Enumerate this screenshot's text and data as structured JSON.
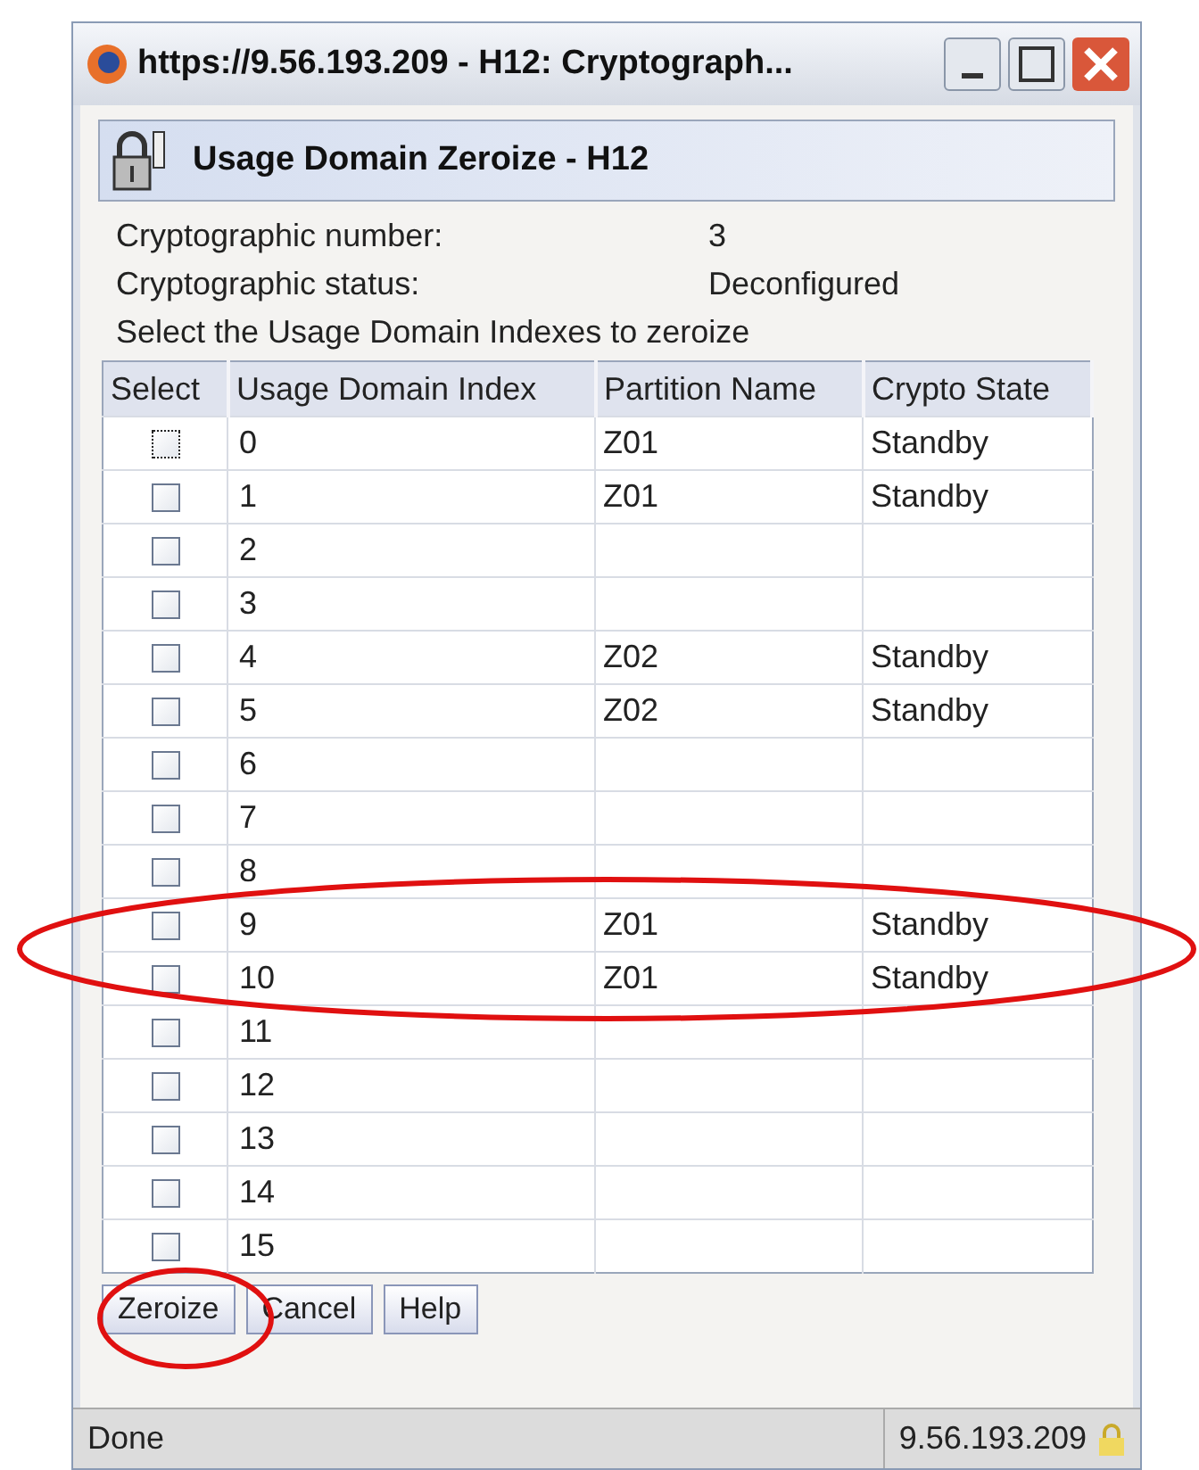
{
  "window": {
    "title": "https://9.56.193.209 - H12: Cryptograph..."
  },
  "header": {
    "title": "Usage Domain Zeroize - H12"
  },
  "info": [
    {
      "label": "Cryptographic number:",
      "value": "3"
    },
    {
      "label": "Cryptographic status:",
      "value": "Deconfigured"
    }
  ],
  "instruction": "Select the Usage Domain Indexes to zeroize",
  "table": {
    "columns": [
      "Select",
      "Usage Domain Index",
      "Partition Name",
      "Crypto State"
    ],
    "rows": [
      {
        "checked": false,
        "focused": true,
        "index": "0",
        "partition": "Z01",
        "state": "Standby"
      },
      {
        "checked": false,
        "focused": false,
        "index": "1",
        "partition": "Z01",
        "state": "Standby"
      },
      {
        "checked": false,
        "focused": false,
        "index": "2"
      },
      {
        "checked": false,
        "focused": false,
        "index": "3"
      },
      {
        "checked": false,
        "focused": false,
        "index": "4",
        "partition": "Z02",
        "state": "Standby"
      },
      {
        "checked": false,
        "focused": false,
        "index": "5",
        "partition": "Z02",
        "state": "Standby"
      },
      {
        "checked": false,
        "focused": false,
        "index": "6"
      },
      {
        "checked": false,
        "focused": false,
        "index": "7"
      },
      {
        "checked": false,
        "focused": false,
        "index": "8"
      },
      {
        "checked": false,
        "focused": false,
        "index": "9",
        "partition": "Z01",
        "state": "Standby"
      },
      {
        "checked": false,
        "focused": false,
        "index": "10",
        "partition": "Z01",
        "state": "Standby"
      },
      {
        "checked": false,
        "focused": false,
        "index": "11"
      },
      {
        "checked": false,
        "focused": false,
        "index": "12"
      },
      {
        "checked": false,
        "focused": false,
        "index": "13"
      },
      {
        "checked": false,
        "focused": false,
        "index": "14"
      },
      {
        "checked": false,
        "focused": false,
        "index": "15"
      }
    ]
  },
  "buttons": [
    "Zeroize",
    "Cancel",
    "Help"
  ],
  "status_bar": {
    "text": "Done",
    "address": "9.56.193.209"
  }
}
